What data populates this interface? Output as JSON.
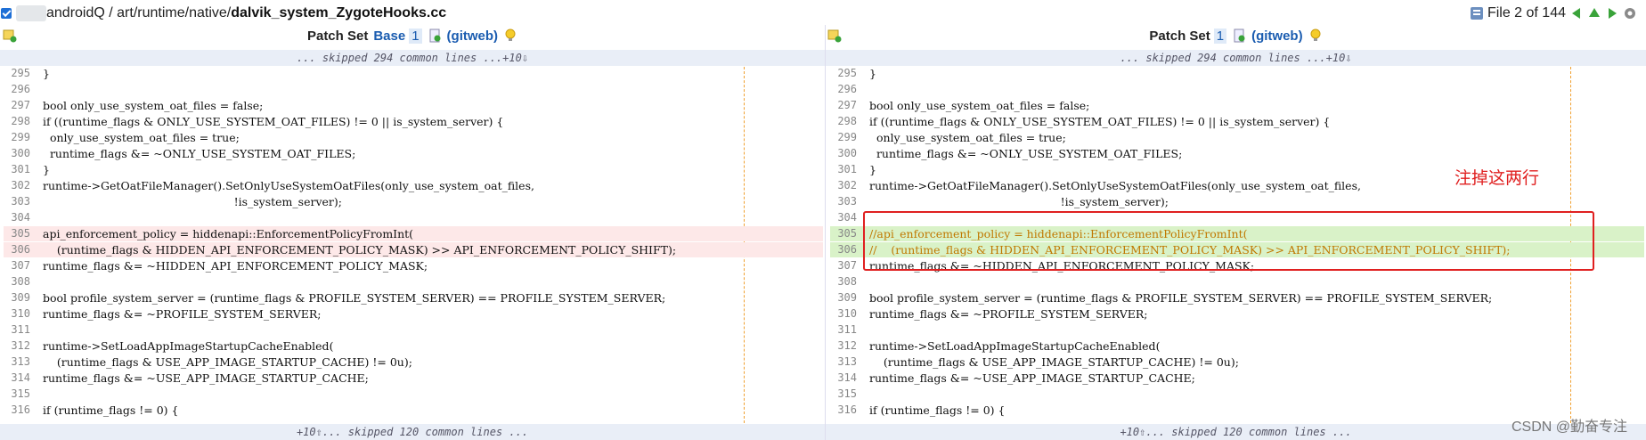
{
  "header": {
    "path_prefix": "androidQ / art/runtime/native/",
    "path_file": "dalvik_system_ZygoteHooks.cc",
    "file_position": "File 2 of 144"
  },
  "left_pane": {
    "patch_set_label": "Patch Set",
    "selected": "Base",
    "number": "1",
    "gitweb": "(gitweb)",
    "skip_top": "... skipped 294 common lines ...+10⇩",
    "skip_bottom": "+10⇧... skipped 120 common lines ..."
  },
  "right_pane": {
    "patch_set_label": "Patch Set",
    "number": "1",
    "gitweb": "(gitweb)",
    "skip_top": "... skipped 294 common lines ...+10⇩",
    "skip_bottom": "+10⇧... skipped 120 common lines ..."
  },
  "left_lines": [
    {
      "n": "295",
      "c": "}",
      "t": ""
    },
    {
      "n": "296",
      "c": "",
      "t": ""
    },
    {
      "n": "297",
      "c": "bool only_use_system_oat_files = false;",
      "t": ""
    },
    {
      "n": "298",
      "c": "if ((runtime_flags & ONLY_USE_SYSTEM_OAT_FILES) != 0 || is_system_server) {",
      "t": ""
    },
    {
      "n": "299",
      "c": "  only_use_system_oat_files = true;",
      "t": ""
    },
    {
      "n": "300",
      "c": "  runtime_flags &= ~ONLY_USE_SYSTEM_OAT_FILES;",
      "t": ""
    },
    {
      "n": "301",
      "c": "}",
      "t": ""
    },
    {
      "n": "302",
      "c": "runtime->GetOatFileManager().SetOnlyUseSystemOatFiles(only_use_system_oat_files,",
      "t": ""
    },
    {
      "n": "303",
      "c": "                                                      !is_system_server);",
      "t": ""
    },
    {
      "n": "304",
      "c": "",
      "t": ""
    },
    {
      "n": "305",
      "c": "api_enforcement_policy = hiddenapi::EnforcementPolicyFromInt(",
      "t": "del"
    },
    {
      "n": "306",
      "c": "    (runtime_flags & HIDDEN_API_ENFORCEMENT_POLICY_MASK) >> API_ENFORCEMENT_POLICY_SHIFT);",
      "t": "del"
    },
    {
      "n": "307",
      "c": "runtime_flags &= ~HIDDEN_API_ENFORCEMENT_POLICY_MASK;",
      "t": ""
    },
    {
      "n": "308",
      "c": "",
      "t": ""
    },
    {
      "n": "309",
      "c": "bool profile_system_server = (runtime_flags & PROFILE_SYSTEM_SERVER) == PROFILE_SYSTEM_SERVER;",
      "t": ""
    },
    {
      "n": "310",
      "c": "runtime_flags &= ~PROFILE_SYSTEM_SERVER;",
      "t": ""
    },
    {
      "n": "311",
      "c": "",
      "t": ""
    },
    {
      "n": "312",
      "c": "runtime->SetLoadAppImageStartupCacheEnabled(",
      "t": ""
    },
    {
      "n": "313",
      "c": "    (runtime_flags & USE_APP_IMAGE_STARTUP_CACHE) != 0u);",
      "t": ""
    },
    {
      "n": "314",
      "c": "runtime_flags &= ~USE_APP_IMAGE_STARTUP_CACHE;",
      "t": ""
    },
    {
      "n": "315",
      "c": "",
      "t": ""
    },
    {
      "n": "316",
      "c": "if (runtime_flags != 0) {",
      "t": ""
    }
  ],
  "right_lines": [
    {
      "n": "295",
      "c": "}",
      "t": ""
    },
    {
      "n": "296",
      "c": "",
      "t": ""
    },
    {
      "n": "297",
      "c": "bool only_use_system_oat_files = false;",
      "t": ""
    },
    {
      "n": "298",
      "c": "if ((runtime_flags & ONLY_USE_SYSTEM_OAT_FILES) != 0 || is_system_server) {",
      "t": ""
    },
    {
      "n": "299",
      "c": "  only_use_system_oat_files = true;",
      "t": ""
    },
    {
      "n": "300",
      "c": "  runtime_flags &= ~ONLY_USE_SYSTEM_OAT_FILES;",
      "t": ""
    },
    {
      "n": "301",
      "c": "}",
      "t": ""
    },
    {
      "n": "302",
      "c": "runtime->GetOatFileManager().SetOnlyUseSystemOatFiles(only_use_system_oat_files,",
      "t": ""
    },
    {
      "n": "303",
      "c": "                                                      !is_system_server);",
      "t": ""
    },
    {
      "n": "304",
      "c": "",
      "t": ""
    },
    {
      "n": "305",
      "c": "//api_enforcement_policy = hiddenapi::EnforcementPolicyFromInt(",
      "t": "add"
    },
    {
      "n": "306",
      "c": "//    (runtime_flags & HIDDEN_API_ENFORCEMENT_POLICY_MASK) >> API_ENFORCEMENT_POLICY_SHIFT);",
      "t": "add"
    },
    {
      "n": "307",
      "c": "runtime_flags &= ~HIDDEN_API_ENFORCEMENT_POLICY_MASK;",
      "t": ""
    },
    {
      "n": "308",
      "c": "",
      "t": ""
    },
    {
      "n": "309",
      "c": "bool profile_system_server = (runtime_flags & PROFILE_SYSTEM_SERVER) == PROFILE_SYSTEM_SERVER;",
      "t": ""
    },
    {
      "n": "310",
      "c": "runtime_flags &= ~PROFILE_SYSTEM_SERVER;",
      "t": ""
    },
    {
      "n": "311",
      "c": "",
      "t": ""
    },
    {
      "n": "312",
      "c": "runtime->SetLoadAppImageStartupCacheEnabled(",
      "t": ""
    },
    {
      "n": "313",
      "c": "    (runtime_flags & USE_APP_IMAGE_STARTUP_CACHE) != 0u);",
      "t": ""
    },
    {
      "n": "314",
      "c": "runtime_flags &= ~USE_APP_IMAGE_STARTUP_CACHE;",
      "t": ""
    },
    {
      "n": "315",
      "c": "",
      "t": ""
    },
    {
      "n": "316",
      "c": "if (runtime_flags != 0) {",
      "t": ""
    }
  ],
  "annotation": {
    "note": "注掉这两行"
  },
  "watermark": "CSDN @勤奋专注",
  "colors": {
    "deleted_bg": "#fde8e8",
    "added_bg": "#d9f2c8",
    "keyword": "#0a45c0",
    "comment": "#c07800",
    "annotation": "#e02020"
  },
  "icons": {
    "left_pane": [
      "add-comment-icon",
      "download-icon",
      "lightbulb-icon"
    ],
    "header": [
      "file-list-icon",
      "prev-file-icon",
      "up-icon",
      "next-file-icon",
      "settings-icon"
    ]
  }
}
